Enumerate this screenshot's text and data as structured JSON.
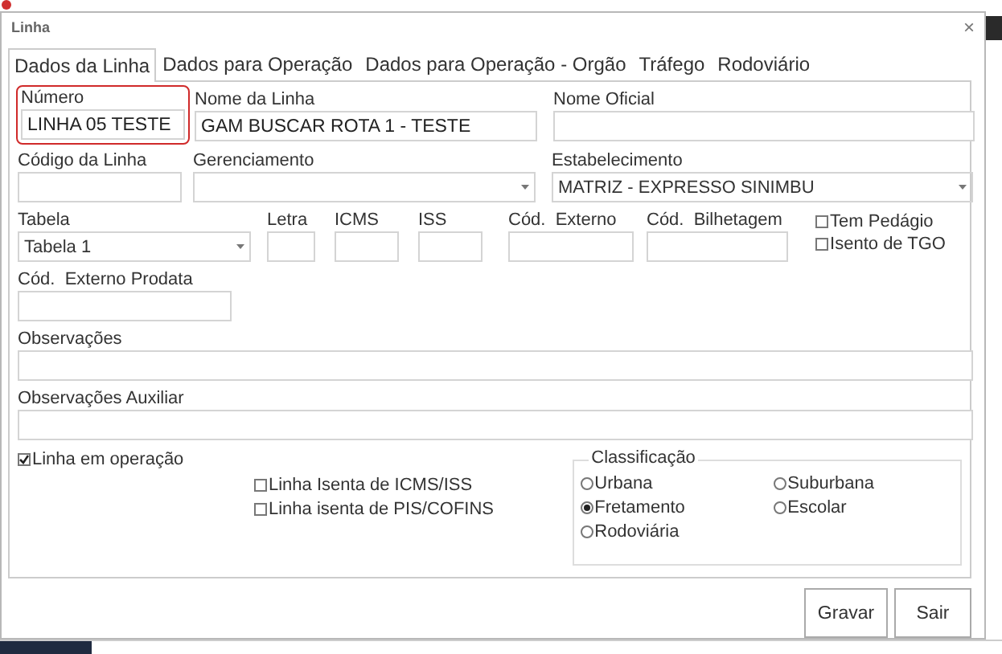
{
  "dialog": {
    "title": "Linha",
    "close": "×"
  },
  "tabs": [
    {
      "label": "Dados da Linha",
      "selected": true
    },
    {
      "label": "Dados para Operação",
      "selected": false
    },
    {
      "label": "Dados para Operação - Orgão",
      "selected": false
    },
    {
      "label": "Tráfego",
      "selected": false
    },
    {
      "label": "Rodoviário",
      "selected": false
    }
  ],
  "field_rows": [
    [
      {
        "label": "Número",
        "value": "LINHA 05 TESTE",
        "kind": "text",
        "highlighted": true
      },
      {
        "label": "Nome da Linha",
        "value": "GAM BUSCAR ROTA 1 - TESTE",
        "kind": "text",
        "highlighted": false
      },
      {
        "label": "Nome Oficial",
        "kind": "text",
        "highlighted": false
      }
    ],
    [
      {
        "label": "Código da Linha",
        "kind": "text",
        "highlighted": false
      },
      {
        "label": "Gerenciamento",
        "kind": "combo",
        "highlighted": false
      },
      {
        "label": "Estabelecimento",
        "value": "MATRIZ - EXPRESSO SINIMBU",
        "kind": "combo",
        "highlighted": false
      }
    ],
    [
      {
        "label": "Tabela",
        "value": "Tabela 1",
        "kind": "combo",
        "highlighted": false
      },
      {
        "label": "Letra",
        "kind": "text",
        "highlighted": false
      },
      {
        "label": "ICMS",
        "kind": "text",
        "highlighted": false
      },
      {
        "label": "ISS",
        "kind": "text",
        "highlighted": false
      },
      {
        "label": "Cód.  Externo",
        "kind": "text",
        "highlighted": false
      },
      {
        "label": "Cód.  Bilhetagem",
        "kind": "text",
        "highlighted": false
      }
    ],
    [
      {
        "label": "Cód.  Externo Prodata",
        "kind": "text",
        "highlighted": false
      }
    ],
    [
      {
        "label": "Observações",
        "kind": "text",
        "highlighted": false
      }
    ],
    [
      {
        "label": "Observações Auxiliar",
        "kind": "text",
        "highlighted": false
      }
    ]
  ],
  "side_checks": [
    {
      "label": "Tem Pedágio",
      "checked": false
    },
    {
      "label": "Isento de TGO",
      "checked": false
    }
  ],
  "operation_check": {
    "label": "Linha em operação",
    "checked": true
  },
  "tax_checks": [
    {
      "label": "Linha Isenta de ICMS/ISS",
      "checked": false
    },
    {
      "label": "Linha isenta de PIS/COFINS",
      "checked": false
    }
  ],
  "classification": {
    "title": "Classificação",
    "options": [
      {
        "label": "Urbana",
        "selected": false
      },
      {
        "label": "Suburbana",
        "selected": false
      },
      {
        "label": "Fretamento",
        "selected": true
      },
      {
        "label": "Escolar",
        "selected": false
      },
      {
        "label": "Rodoviária",
        "selected": false
      }
    ]
  },
  "buttons": [
    "Gravar",
    "Sair"
  ]
}
